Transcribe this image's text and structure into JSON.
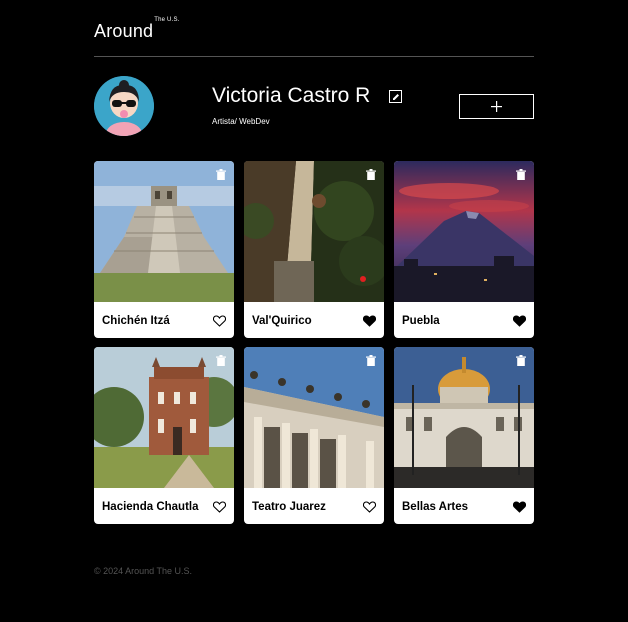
{
  "header": {
    "logo_main": "Around",
    "logo_sup": "The U.S."
  },
  "profile": {
    "name": "Victoria Castro R",
    "role": "Artista/ WebDev"
  },
  "cards": [
    {
      "title": "Chichén Itzá",
      "liked": false
    },
    {
      "title": "Val'Quirico",
      "liked": true
    },
    {
      "title": "Puebla",
      "liked": true
    },
    {
      "title": "Hacienda Chautla",
      "liked": false
    },
    {
      "title": "Teatro Juarez",
      "liked": false
    },
    {
      "title": "Bellas Artes",
      "liked": true
    }
  ],
  "footer": {
    "copyright": "© 2024 Around The U.S."
  },
  "colors": {
    "background": "#000000",
    "card": "#ffffff",
    "divider": "#545454",
    "footer_text": "#545454"
  },
  "icons": [
    "edit-icon",
    "plus-icon",
    "trash-icon",
    "heart-icon"
  ]
}
